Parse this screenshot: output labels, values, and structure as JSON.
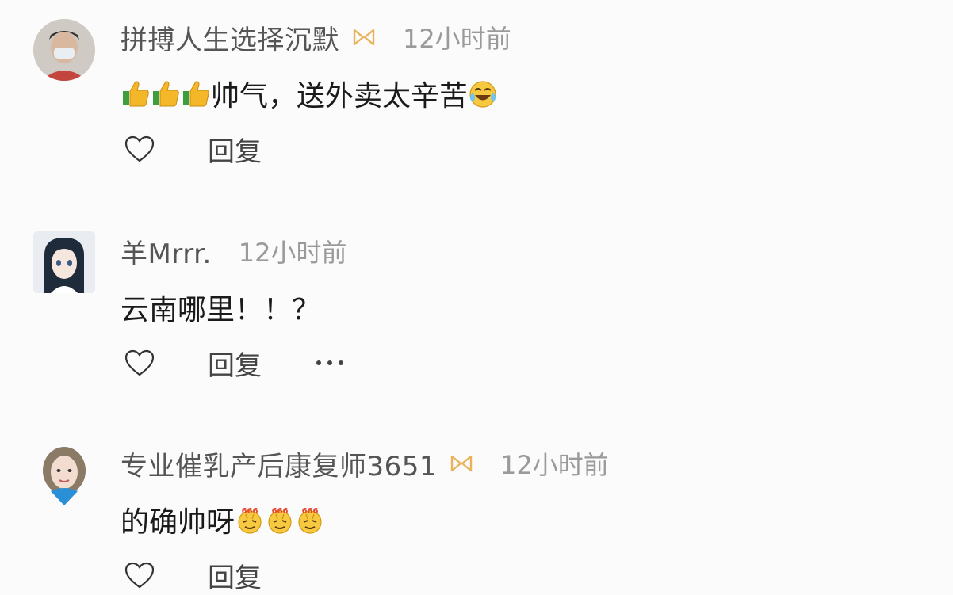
{
  "comments": [
    {
      "username": "拼搏人生选择沉默",
      "has_vip_badge": true,
      "time": "12小时前",
      "text_before_emoji": "",
      "leading_emoji": "thumbs-up-icon ×3",
      "text": "帅气，送外卖太辛苦",
      "trailing_emoji": "laughing-tears-emoji",
      "reply_label": "回复",
      "has_more": false
    },
    {
      "username": "羊Mrrr.",
      "has_vip_badge": false,
      "time": "12小时前",
      "text": "云南哪里！！？",
      "reply_label": "回复",
      "has_more": true
    },
    {
      "username": "专业催乳产后康复师3651",
      "has_vip_badge": true,
      "time": "12小时前",
      "text": "的确帅呀",
      "trailing_emoji": "666-emoji ×3",
      "reply_label": "回复",
      "has_more": false
    }
  ],
  "colors": {
    "username": "#555555",
    "time": "#9a9a9a",
    "vip_badge": "#e8b35a",
    "background": "#fbfbfb"
  }
}
